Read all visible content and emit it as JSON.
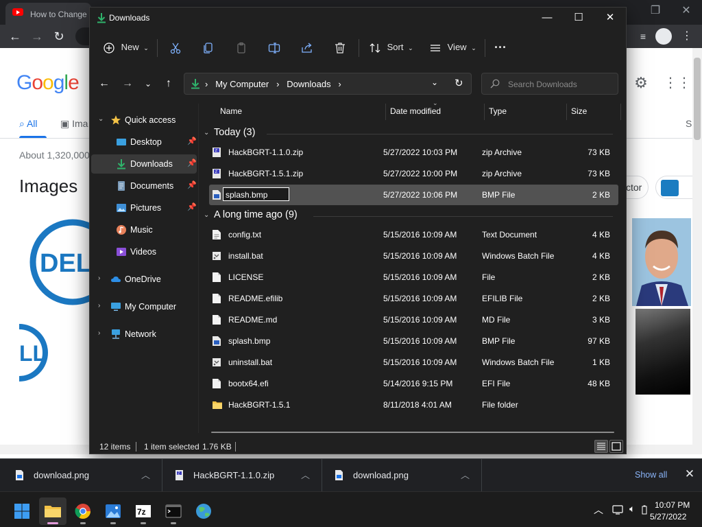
{
  "browser": {
    "tab_title": "How to Change",
    "google_tabs": {
      "all": "All",
      "images": "Ima"
    },
    "stats": "About 1,320,000",
    "images_heading": "Images",
    "partial_s": "S",
    "chip_text": "ctor"
  },
  "explorer": {
    "title": "Downloads",
    "commands": {
      "new": "New",
      "sort": "Sort",
      "view": "View",
      "more": "···"
    },
    "address": {
      "crumb1": "My Computer",
      "crumb2": "Downloads"
    },
    "search_placeholder": "Search Downloads",
    "nav": [
      {
        "label": "Quick access",
        "icon": "star-icon"
      },
      {
        "label": "Desktop",
        "icon": "desktop-icon",
        "pinned": true
      },
      {
        "label": "Downloads",
        "icon": "download-icon",
        "pinned": true,
        "selected": true
      },
      {
        "label": "Documents",
        "icon": "document-icon",
        "pinned": true
      },
      {
        "label": "Pictures",
        "icon": "pictures-icon",
        "pinned": true
      },
      {
        "label": "Music",
        "icon": "music-icon"
      },
      {
        "label": "Videos",
        "icon": "videos-icon"
      },
      {
        "label": "OneDrive",
        "icon": "cloud-icon"
      },
      {
        "label": "My Computer",
        "icon": "computer-icon"
      },
      {
        "label": "Network",
        "icon": "network-icon"
      }
    ],
    "columns": {
      "name": "Name",
      "date": "Date modified",
      "type": "Type",
      "size": "Size"
    },
    "groups": [
      {
        "label": "Today (3)"
      },
      {
        "label": "A long time ago (9)"
      }
    ],
    "rename_value": "splash.bmp",
    "files_today": [
      {
        "name": "HackBGRT-1.1.0.zip",
        "date": "5/27/2022 10:03 PM",
        "type": "zip Archive",
        "size": "73 KB",
        "icon": "zip-icon"
      },
      {
        "name": "HackBGRT-1.5.1.zip",
        "date": "5/27/2022 10:00 PM",
        "type": "zip Archive",
        "size": "73 KB",
        "icon": "zip-icon"
      },
      {
        "name": "splash.bmp",
        "date": "5/27/2022 10:06 PM",
        "type": "BMP File",
        "size": "2 KB",
        "icon": "bmp-icon",
        "selected": true
      }
    ],
    "files_old": [
      {
        "name": "config.txt",
        "date": "5/15/2016 10:09 AM",
        "type": "Text Document",
        "size": "4 KB",
        "icon": "text-file-icon"
      },
      {
        "name": "install.bat",
        "date": "5/15/2016 10:09 AM",
        "type": "Windows Batch File",
        "size": "4 KB",
        "icon": "batch-file-icon"
      },
      {
        "name": "LICENSE",
        "date": "5/15/2016 10:09 AM",
        "type": "File",
        "size": "2 KB",
        "icon": "file-icon"
      },
      {
        "name": "README.efilib",
        "date": "5/15/2016 10:09 AM",
        "type": "EFILIB File",
        "size": "2 KB",
        "icon": "file-icon"
      },
      {
        "name": "README.md",
        "date": "5/15/2016 10:09 AM",
        "type": "MD File",
        "size": "3 KB",
        "icon": "file-icon"
      },
      {
        "name": "splash.bmp",
        "date": "5/15/2016 10:09 AM",
        "type": "BMP File",
        "size": "97 KB",
        "icon": "bmp-icon"
      },
      {
        "name": "uninstall.bat",
        "date": "5/15/2016 10:09 AM",
        "type": "Windows Batch File",
        "size": "1 KB",
        "icon": "batch-file-icon"
      },
      {
        "name": "bootx64.efi",
        "date": "5/14/2016 9:15 PM",
        "type": "EFI File",
        "size": "48 KB",
        "icon": "file-icon"
      },
      {
        "name": "HackBGRT-1.5.1",
        "date": "8/11/2018 4:01 AM",
        "type": "File folder",
        "size": "",
        "icon": "folder-icon"
      }
    ],
    "status": {
      "items": "12 items",
      "selected": "1 item selected",
      "size": "1.76 KB"
    }
  },
  "downloads_bar": {
    "items": [
      {
        "name": "download.png",
        "icon": "image-file-icon"
      },
      {
        "name": "HackBGRT-1.1.0.zip",
        "icon": "zip-icon"
      },
      {
        "name": "download.png",
        "icon": "image-file-icon"
      }
    ],
    "show_all": "Show all"
  },
  "taskbar": {
    "time": "10:07 PM",
    "date": "5/27/2022"
  },
  "colors": {
    "explorer_bg": "#202020",
    "selection": "#525252",
    "accent_green": "#2fb36b",
    "folder_yellow": "#f3c246",
    "link_blue": "#8ab4f8"
  }
}
